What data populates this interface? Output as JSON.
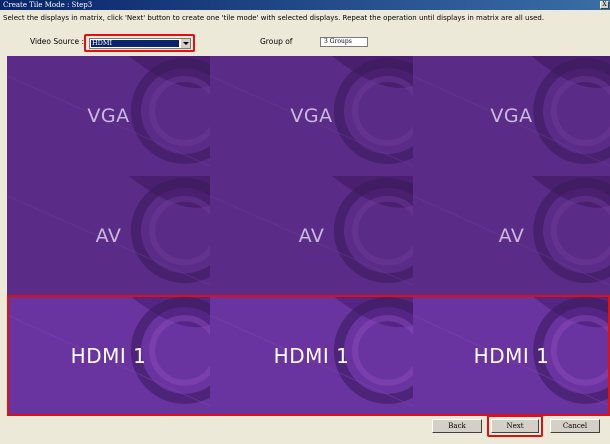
{
  "window": {
    "title": "Create Tile Mode : Step3",
    "close_label": "X"
  },
  "instructions": "Select the displays in matrix, click 'Next' button to create one 'tile mode' with selected displays. Repeat the operation until displays in matrix are all used.",
  "video_source": {
    "label": "Video Source :",
    "value": "HDMI"
  },
  "group": {
    "label": "Group of",
    "value": "3 Groups"
  },
  "matrix": {
    "rows": [
      {
        "label": "VGA",
        "tiles": [
          "VGA",
          "VGA",
          "VGA"
        ],
        "selected": false
      },
      {
        "label": "AV",
        "tiles": [
          "AV",
          "AV",
          "AV"
        ],
        "selected": false
      },
      {
        "label": "HDMI 1",
        "tiles": [
          "HDMI 1",
          "HDMI 1",
          "HDMI 1"
        ],
        "selected": true
      }
    ]
  },
  "buttons": {
    "back": "Back",
    "next": "Next",
    "cancel": "Cancel"
  },
  "colors": {
    "accent_highlight": "#e01010",
    "tile_purple": "#5b2c87",
    "title_bar": "#0a246a"
  }
}
